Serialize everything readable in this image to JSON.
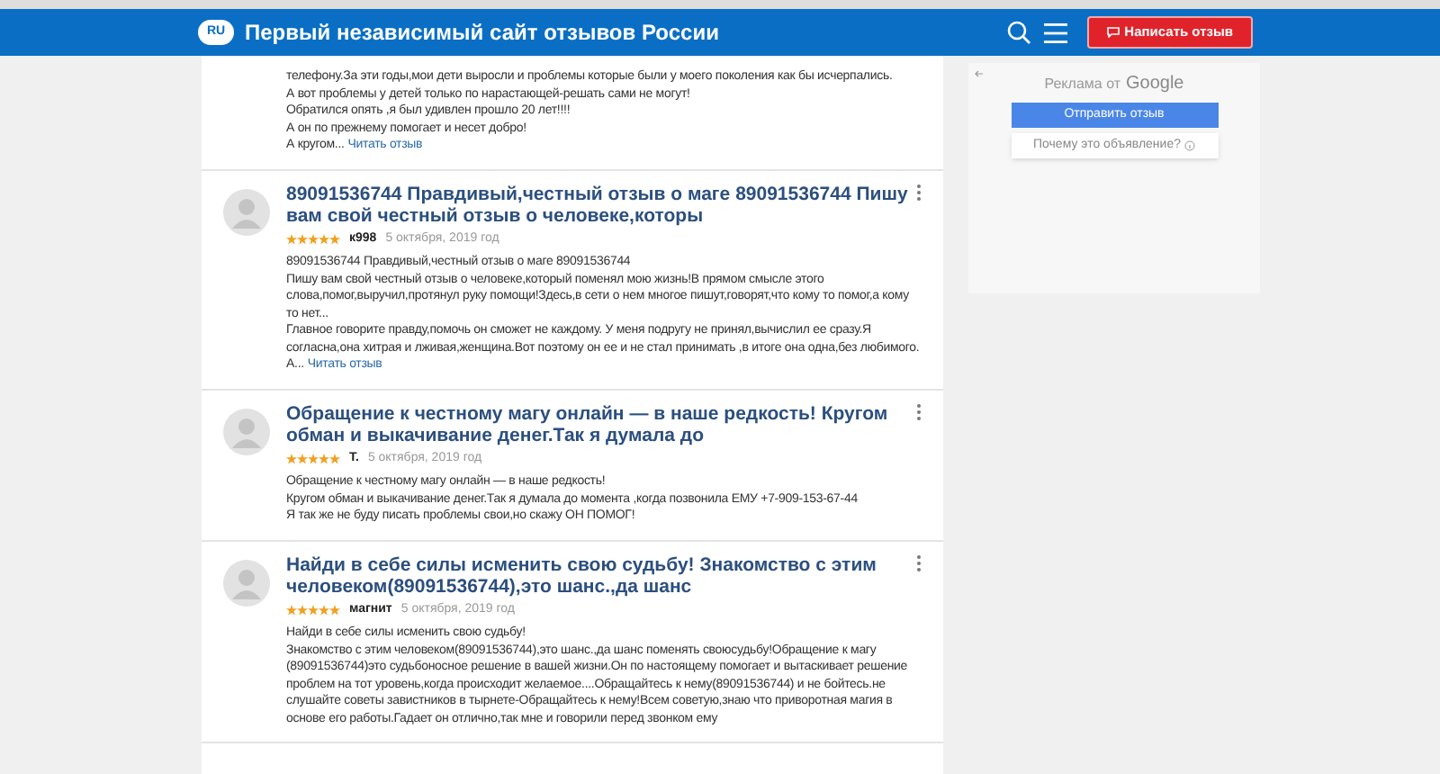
{
  "header": {
    "logo": "RU",
    "title": "Первый независимый сайт отзывов России",
    "write_button": "Написать отзыв"
  },
  "reviews": [
    {
      "kind": "partial",
      "lines": [
        "телефону.За эти годы,мои дети выросли и проблемы которые были у моего поколения как бы исчерпались.",
        "А вот проблемы у детей только по нарастающей-решать сами не могут!",
        "Обратился опять ,я был удивлен прошло 20 лет!!!!",
        "А он по прежнему помогает и несет добро!",
        "А кругом..."
      ],
      "read_more": "Читать отзыв"
    },
    {
      "kind": "full",
      "title": "89091536744 Правдивый,честный отзыв о маге 89091536744 Пишу вам свой честный отзыв о человеке,которы",
      "stars": 5,
      "author": "к998",
      "date": "5 октября, 2019 год",
      "lines": [
        "89091536744 Правдивый,честный отзыв о маге 89091536744",
        "Пишу вам свой честный отзыв о человеке,который поменял мою жизнь!В прямом смысле этого слова,помог,выручил,протянул руку помощи!Здесь,в сети о нем многое пишут,говорят,что кому то помог,а кому то нет...",
        "Главное говорите правду,помочь он сможет не каждому. У меня подругу не принял,вычислил ее сразу.Я согласна,она хитрая и лживая,женщина.Вот поэтому он ее и не стал принимать ,в итоге она одна,без любимого.",
        "А..."
      ],
      "read_more": "Читать отзыв"
    },
    {
      "kind": "full",
      "title": "Обращение к честному магу онлайн — в наше редкость! Кругом обман и выкачивание денег.Так я думала до",
      "stars": 5,
      "author": "Т.",
      "date": "5 октября, 2019 год",
      "lines": [
        "Обращение к честному магу онлайн — в наше редкость!",
        "Кругом обман и выкачивание денег.Так я думала до момента ,когда позвонила ЕМУ +7-909-153-67-44",
        "Я так же не буду писать проблемы свои,но скажу ОН ПОМОГ!"
      ]
    },
    {
      "kind": "full",
      "title": "Найди в себе силы исменить свою судьбу! Знакомство с этим человеком(89091536744),это шанс.,да шанс",
      "stars": 5,
      "author": "магнит",
      "date": "5 октября, 2019 год",
      "lines": [
        "Найди в себе силы исменить свою судьбу!",
        "Знакомство с этим человеком(89091536744),это шанс.,да шанс поменять своюсудьбу!Обращение к магу (89091536744)это судьбоносное решение в вашей жизни.Он по настоящему помогает и вытаскивает решение проблем на тот уровень,когда происходит желаемое....Обращайтесь к нему(89091536744) и не бойтесь.не слушайте советы завистников в тырнете-Обращайтесь к нему!Всем советую,знаю что приворотная магия в основе его работы.Гадает он отлично,так мне и говорили перед звонком ему"
      ]
    }
  ],
  "ad": {
    "label": "Реклама от",
    "brand": "Google",
    "send_button": "Отправить отзыв",
    "why_button": "Почему это объявление?"
  }
}
